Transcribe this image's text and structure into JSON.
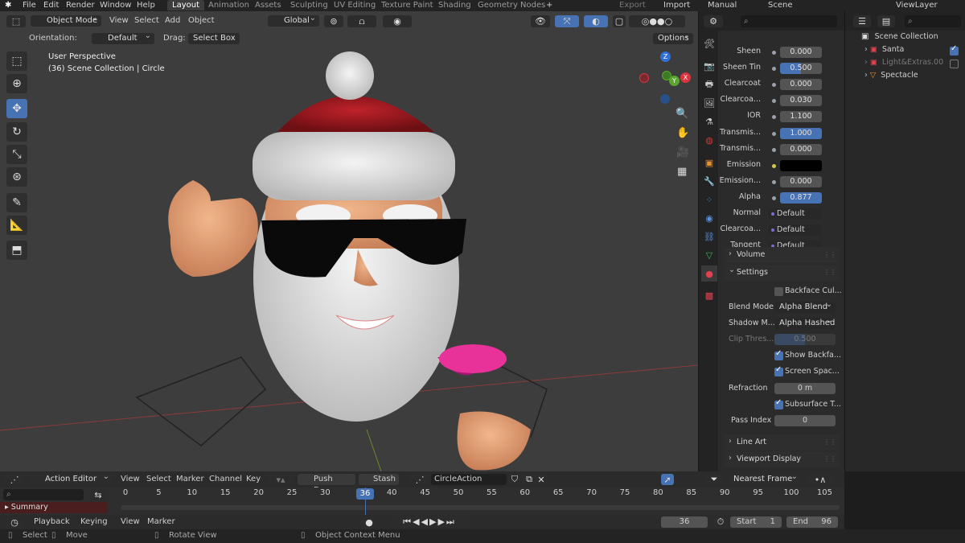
{
  "menu": [
    "File",
    "Edit",
    "Render",
    "Window",
    "Help"
  ],
  "workspaces": [
    "Layout",
    "Animation",
    "Assets",
    "Sculpting",
    "UV Editing",
    "Texture Paint",
    "Shading",
    "Geometry Nodes"
  ],
  "add_tab_label": "+",
  "topright": {
    "export": "Export",
    "import": "Import",
    "manual": "Manual",
    "scene": "Scene",
    "viewlayer": "ViewLayer"
  },
  "viewport_header": {
    "mode": "Object Mode",
    "view": "View",
    "select": "Select",
    "add": "Add",
    "object": "Object",
    "transform": "Global"
  },
  "tool_settings": {
    "orientation_label": "Orientation:",
    "orientation_value": "Default",
    "drag_label": "Drag:",
    "drag_value": "Select Box",
    "options": "Options"
  },
  "viewport_info": {
    "line1": "User Perspective",
    "line2": "(36) Scene Collection | Circle"
  },
  "gizmo": {
    "z": "Z",
    "x": "X",
    "y": "Y"
  },
  "properties": {
    "search_placeholder": "",
    "rows": [
      {
        "label": "Sheen",
        "value": "0.000",
        "style": "normal"
      },
      {
        "label": "Sheen Tin",
        "value": "0.500",
        "style": "blue-partial"
      },
      {
        "label": "Clearcoat",
        "value": "0.000",
        "style": "normal"
      },
      {
        "label": "Clearcoa...",
        "value": "0.030",
        "style": "normal"
      },
      {
        "label": "IOR",
        "value": "1.100",
        "style": "normal"
      },
      {
        "label": "Transmis...",
        "value": "1.000",
        "style": "blue"
      },
      {
        "label": "Transmis...",
        "value": "0.000",
        "style": "normal"
      },
      {
        "label": "Emission",
        "value": "",
        "style": "black"
      },
      {
        "label": "Emission...",
        "value": "0.000",
        "style": "normal"
      },
      {
        "label": "Alpha",
        "value": "0.877",
        "style": "blue"
      },
      {
        "label": "Normal",
        "value": "Default",
        "style": "link"
      },
      {
        "label": "Clearcoa...",
        "value": "Default",
        "style": "link"
      },
      {
        "label": "Tangent",
        "value": "Default",
        "style": "link"
      }
    ],
    "volume_label": "Volume",
    "settings_label": "Settings",
    "backface_culling": "Backface Cul...",
    "blend_mode_label": "Blend Mode",
    "blend_mode_value": "Alpha Blend",
    "shadow_mode_label": "Shadow M...",
    "shadow_mode_value": "Alpha Hashed",
    "clip_label": "Clip Thres...",
    "clip_value": "0.500",
    "show_backface": "Show Backfa...",
    "screen_space": "Screen Spac...",
    "refraction_label": "Refraction",
    "refraction_value": "0 m",
    "subsurface": "Subsurface T...",
    "pass_index_label": "Pass Index",
    "pass_index_value": "0",
    "line_art": "Line Art",
    "viewport_display": "Viewport Display"
  },
  "outliner": {
    "search_placeholder": "",
    "root": "Scene Collection",
    "items": [
      {
        "label": "Santa"
      },
      {
        "label": "Light&Extras.00"
      },
      {
        "label": "Spectacle"
      }
    ]
  },
  "action_editor": {
    "mode": "Action Editor",
    "view": "View",
    "select": "Select",
    "marker": "Marker",
    "channel": "Channel",
    "key": "Key",
    "push_down": "Push Down",
    "stash": "Stash",
    "action_name": "CircleAction",
    "snap": "Nearest Frame",
    "summary": "Summary",
    "ticks": [
      "0",
      "5",
      "10",
      "15",
      "20",
      "25",
      "30",
      "36",
      "40",
      "45",
      "50",
      "55",
      "60",
      "65",
      "70",
      "75",
      "80",
      "85",
      "90",
      "95",
      "100",
      "105"
    ],
    "current_frame": "36"
  },
  "timeline": {
    "playback": "Playback",
    "keying": "Keying",
    "view": "View",
    "marker": "Marker",
    "frame": "36",
    "start_label": "Start",
    "start": "1",
    "end_label": "End",
    "end": "96"
  },
  "statusbar": {
    "select": "Select",
    "move": "Move",
    "rotate": "Rotate View",
    "context": "Object Context Menu"
  },
  "colors": {
    "accent": "#4772b3",
    "viewport": "#3d3d3d",
    "panel": "#2b2b2b"
  }
}
